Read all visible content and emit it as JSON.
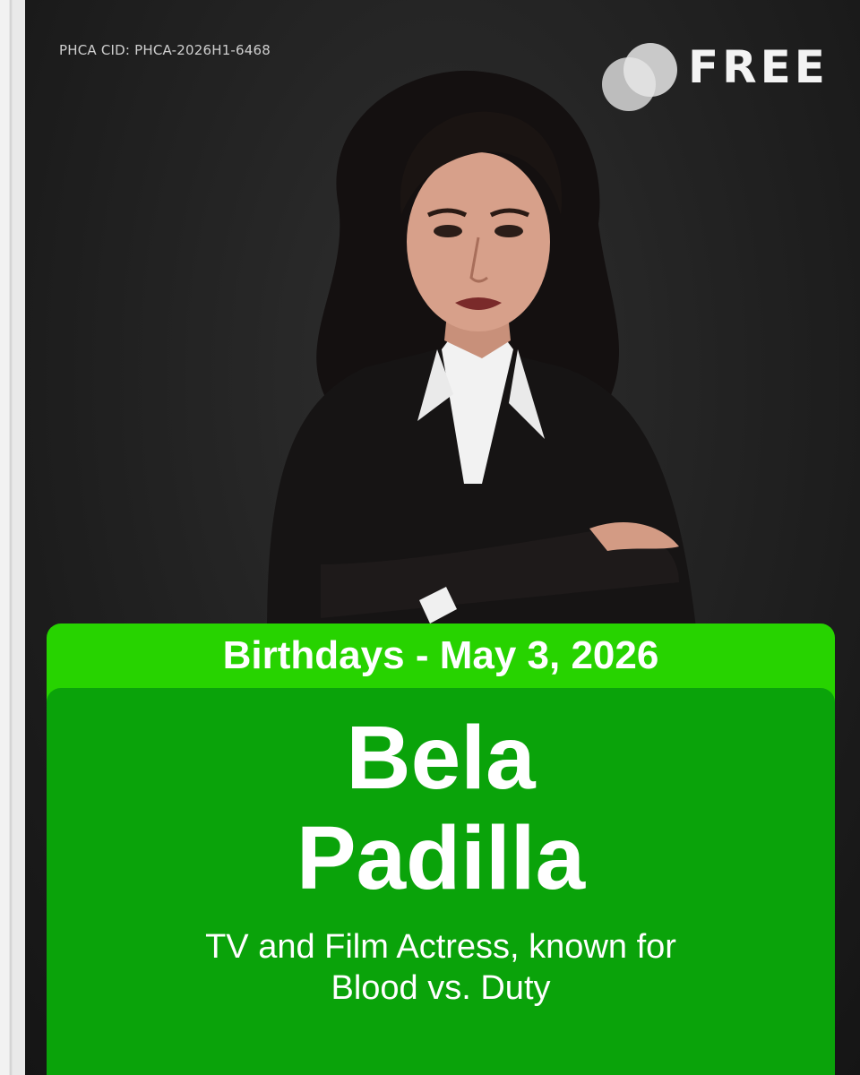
{
  "header": {
    "cid": "PHCA CID: PHCA-2026H1-6468",
    "logo_text": "FREE"
  },
  "banner": {
    "heading": "Birthdays - May 3, 2026",
    "name_line1": "Bela",
    "name_line2": "Padilla",
    "description_line1": "TV and Film Actress, known for",
    "description_line2": "Blood vs. Duty"
  },
  "colors": {
    "background": "#1b1b1b",
    "banner_light_green": "#27d300",
    "banner_dark_green": "#0aa30a",
    "text": "#ffffff"
  },
  "icons": [
    "logo-circles-icon"
  ]
}
